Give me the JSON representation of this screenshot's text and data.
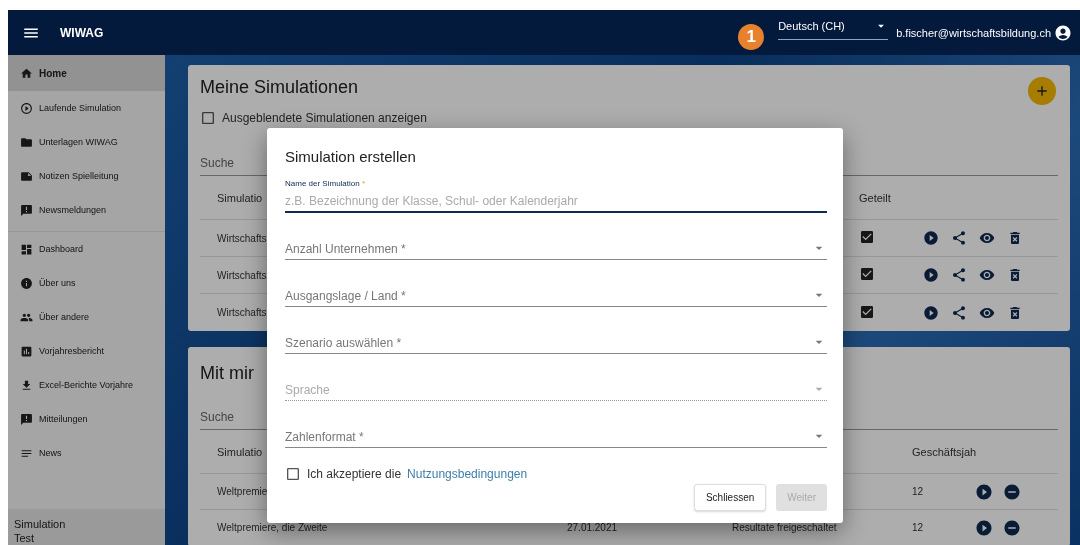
{
  "app_bar": {
    "title": "WIWAG",
    "badge": "1",
    "language": "Deutsch (CH)",
    "user": "b.fischer@wirtschaftsbildung.ch"
  },
  "sidebar": {
    "sections": [
      [
        {
          "label": "Home",
          "selected": true
        },
        {
          "label": "Laufende Simulation",
          "selected": false
        },
        {
          "label": "Unterlagen WIWAG",
          "selected": false
        },
        {
          "label": "Notizen Spielleitung",
          "selected": false
        },
        {
          "label": "Newsmeldungen",
          "selected": false
        }
      ],
      [
        {
          "label": "Dashboard",
          "selected": false
        },
        {
          "label": "Über uns",
          "selected": false
        },
        {
          "label": "Über andere",
          "selected": false
        },
        {
          "label": "Vorjahresbericht",
          "selected": false
        },
        {
          "label": "Excel-Berichte Vorjahre",
          "selected": false
        },
        {
          "label": "Mitteilungen",
          "selected": false
        },
        {
          "label": "News",
          "selected": false
        }
      ]
    ],
    "footer": {
      "label": "Simulation",
      "value": "Test"
    }
  },
  "my_simulations": {
    "title": "Meine Simulationen",
    "show_hidden": {
      "label": "Ausgeblendete Simulationen anzeigen",
      "checked": false
    },
    "search_placeholder": "Suche",
    "columns": [
      "Simulatio",
      "Geteilt"
    ],
    "rows": [
      {
        "name": "Wirtschafts",
        "shared": true
      },
      {
        "name": "Wirtschafts",
        "shared": true
      },
      {
        "name": "Wirtschafts",
        "shared": true
      }
    ]
  },
  "shared_with_me": {
    "title": "Mit mir",
    "search_placeholder": "Suche",
    "columns": [
      "Simulatio",
      "Geschäftsjah"
    ],
    "rows": [
      {
        "name": "Weltpremie",
        "year": "12"
      },
      {
        "name": "Weltpremiere, die Zweite",
        "date": "27.01.2021",
        "status": "Resultate freigeschaltet",
        "year": "12"
      }
    ]
  },
  "dialog": {
    "title": "Simulation erstellen",
    "fields": [
      {
        "kind": "text",
        "label": "Name der Simulation",
        "required_mark": "*",
        "placeholder": "z.B. Bezeichnung der Klasse, Schul- oder Kalenderjahr",
        "focused": true
      },
      {
        "kind": "select",
        "label": "Anzahl Unternehmen *",
        "focused": false,
        "disabled": false
      },
      {
        "kind": "select",
        "label": "Ausgangslage / Land *",
        "focused": false,
        "disabled": false
      },
      {
        "kind": "select",
        "label": "Szenario auswählen *",
        "focused": false,
        "disabled": false
      },
      {
        "kind": "select",
        "label": "Sprache",
        "focused": false,
        "disabled": true
      },
      {
        "kind": "select",
        "label": "Zahlenformat *",
        "focused": false,
        "disabled": false
      }
    ],
    "terms": {
      "text": "Ich akzeptiere die",
      "link": "Nutzungsbedingungen",
      "checked": false
    },
    "buttons": [
      {
        "label": "Schliessen",
        "disabled": false
      },
      {
        "label": "Weiter",
        "disabled": true
      }
    ]
  }
}
